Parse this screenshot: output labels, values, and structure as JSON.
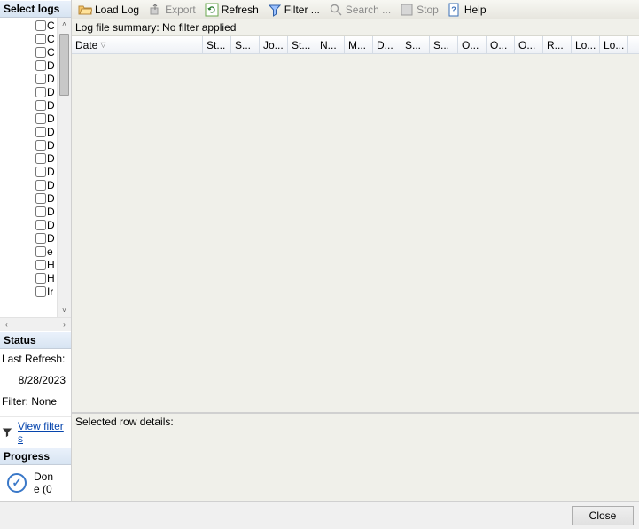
{
  "sidebar": {
    "select_logs_header": "Select logs",
    "items": [
      {
        "label": "C"
      },
      {
        "label": "C"
      },
      {
        "label": "C"
      },
      {
        "label": "D"
      },
      {
        "label": "D"
      },
      {
        "label": "D"
      },
      {
        "label": "D"
      },
      {
        "label": "D"
      },
      {
        "label": "D"
      },
      {
        "label": "D"
      },
      {
        "label": "D"
      },
      {
        "label": "D"
      },
      {
        "label": "D"
      },
      {
        "label": "D"
      },
      {
        "label": "D"
      },
      {
        "label": "D"
      },
      {
        "label": "D"
      },
      {
        "label": "e"
      },
      {
        "label": "H"
      },
      {
        "label": "H"
      },
      {
        "label": "Ir"
      }
    ],
    "status_header": "Status",
    "last_refresh_label": "Last Refresh:",
    "last_refresh_value": "8/28/2023",
    "filter_label": "Filter: None",
    "view_filters_link": "View filter s",
    "progress_header": "Progress",
    "progress_text1": "Don",
    "progress_text2": "e (0"
  },
  "toolbar": {
    "load_log": "Load Log",
    "export": "Export",
    "refresh": "Refresh",
    "filter": "Filter ...",
    "search": "Search ...",
    "stop": "Stop",
    "help": "Help"
  },
  "main": {
    "summary": "Log file summary: No filter applied",
    "columns": [
      {
        "label": "Date",
        "width": 148,
        "sorted": true
      },
      {
        "label": "St...",
        "width": 32
      },
      {
        "label": "S...",
        "width": 32
      },
      {
        "label": "Jo...",
        "width": 32
      },
      {
        "label": "St...",
        "width": 32
      },
      {
        "label": "N...",
        "width": 32
      },
      {
        "label": "M...",
        "width": 32
      },
      {
        "label": "D...",
        "width": 32
      },
      {
        "label": "S...",
        "width": 32
      },
      {
        "label": "S...",
        "width": 32
      },
      {
        "label": "O...",
        "width": 32
      },
      {
        "label": "O...",
        "width": 32
      },
      {
        "label": "O...",
        "width": 32
      },
      {
        "label": "R...",
        "width": 32
      },
      {
        "label": "Lo...",
        "width": 32
      },
      {
        "label": "Lo...",
        "width": 32
      }
    ],
    "details_label": "Selected row details:"
  },
  "footer": {
    "close": "Close"
  }
}
